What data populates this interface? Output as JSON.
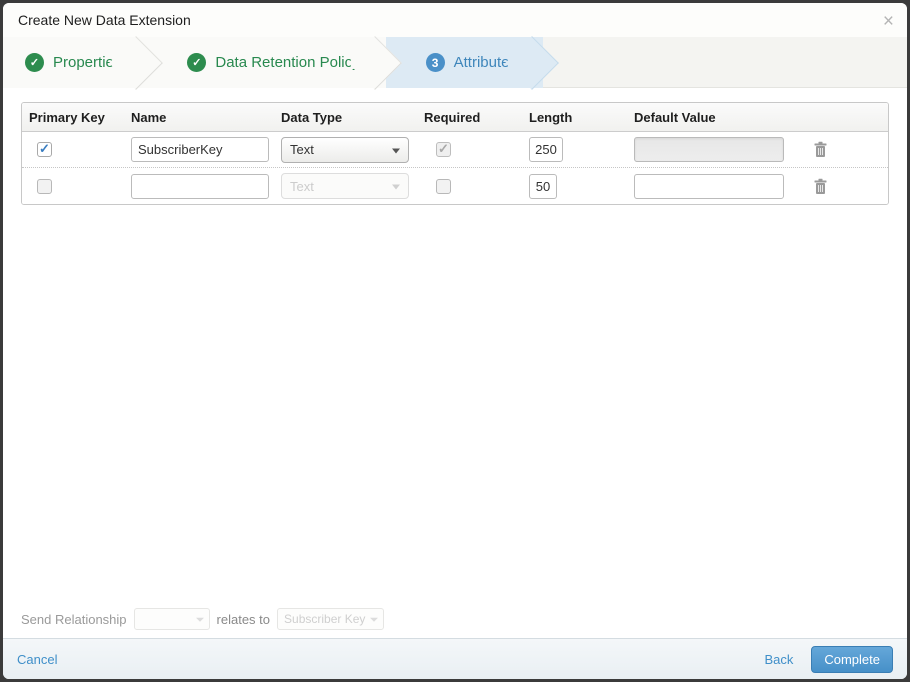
{
  "modal": {
    "title": "Create New Data Extension"
  },
  "icons": {
    "close": "×",
    "check": "✓"
  },
  "steps": [
    {
      "label": "Properties",
      "status": "complete"
    },
    {
      "label": "Data Retention Policy",
      "status": "complete"
    },
    {
      "label": "Attributes",
      "status": "current",
      "number": "3"
    }
  ],
  "table": {
    "columns": [
      "Primary Key",
      "Name",
      "Data Type",
      "Required",
      "Length",
      "Default Value"
    ],
    "rows": [
      {
        "primary_key": true,
        "name": "SubscriberKey",
        "data_type": "Text",
        "data_type_disabled": false,
        "required": true,
        "required_disabled": true,
        "length": "250",
        "default_value": "",
        "default_disabled": true
      },
      {
        "primary_key": false,
        "name": "",
        "data_type": "Text",
        "data_type_disabled": true,
        "required": false,
        "required_disabled": false,
        "length": "50",
        "default_value": "",
        "default_disabled": false
      }
    ]
  },
  "send_relationship": {
    "label": "Send Relationship",
    "relates_to_label": "relates to",
    "source_value": "",
    "target_value": "Subscriber Key"
  },
  "footer": {
    "cancel_label": "Cancel",
    "back_label": "Back",
    "complete_label": "Complete"
  },
  "colors": {
    "step_complete_green": "#2d8c4e",
    "step_current_blue": "#4a90c8",
    "step_current_bg": "#ddeaf4",
    "link_blue": "#3f8fc9",
    "complete_button_blue": "#4690c8",
    "checkbox_check_blue": "#3a7dc0"
  }
}
